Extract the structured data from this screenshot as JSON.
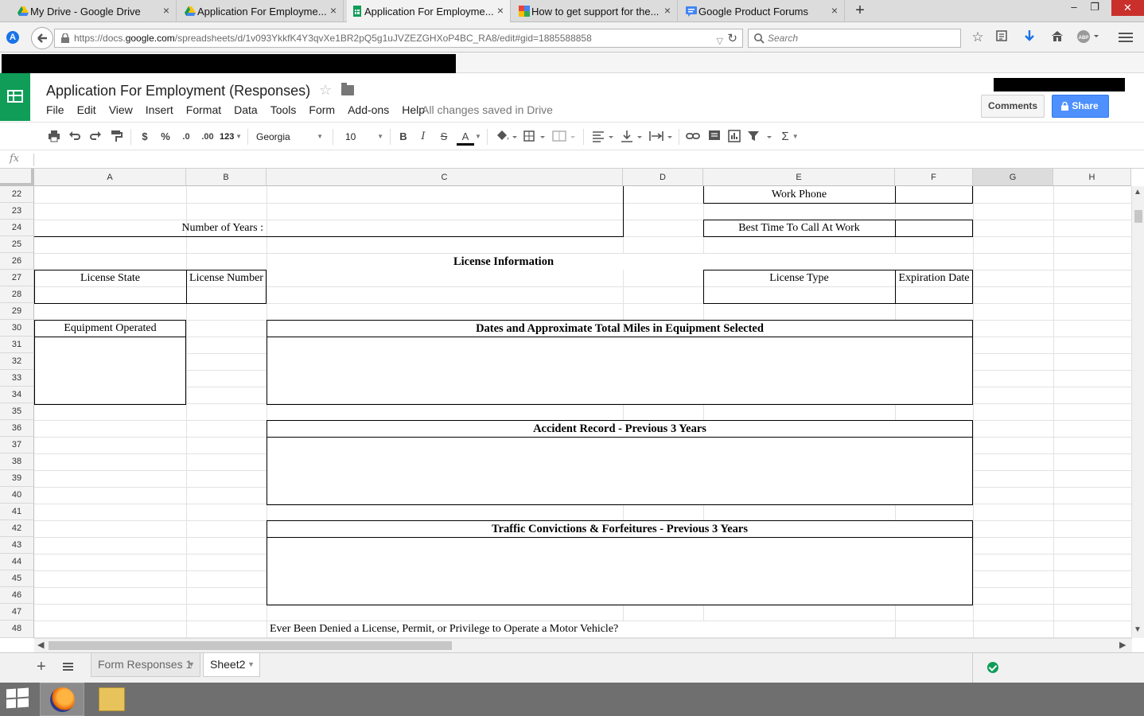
{
  "browser": {
    "tabs": [
      {
        "label": "My Drive - Google Drive"
      },
      {
        "label": "Application For Employme..."
      },
      {
        "label": "Application For Employme..."
      },
      {
        "label": "How to get support for the..."
      },
      {
        "label": "Google Product Forums"
      }
    ],
    "url_prefix": "https://docs.",
    "url_host": "google.com",
    "url_rest": "/spreadsheets/d/1v093YkkfK4Y3qvXe1BR2pQ5g1uJVZEZGHXoP4BC_RA8/edit#gid=1885588858",
    "search_placeholder": "Search"
  },
  "doc": {
    "title": "Application For Employment (Responses)",
    "menu": [
      "File",
      "Edit",
      "View",
      "Insert",
      "Format",
      "Data",
      "Tools",
      "Form",
      "Add-ons",
      "Help"
    ],
    "status": "All changes saved in Drive",
    "comments_label": "Comments",
    "share_label": "Share"
  },
  "toolbar": {
    "currency": "$",
    "percent": "%",
    "dec_less": ".0",
    "dec_more": ".00",
    "format_more": "123",
    "font": "Georgia",
    "size": "10",
    "bold": "B",
    "italic": "I",
    "strike": "S",
    "text_color": "A"
  },
  "formula": {
    "fx": "fx"
  },
  "grid": {
    "columns": [
      "A",
      "B",
      "C",
      "D",
      "E",
      "F",
      "G",
      "H"
    ],
    "rows": [
      "22",
      "23",
      "24",
      "25",
      "26",
      "27",
      "28",
      "29",
      "30",
      "31",
      "32",
      "33",
      "34",
      "35",
      "36",
      "37",
      "38",
      "39",
      "40",
      "41",
      "42",
      "43",
      "44",
      "45",
      "46",
      "47",
      "48"
    ],
    "cells": {
      "work_phone": "Work Phone",
      "number_of_years": "Number of Years :",
      "best_time": "Best Time To Call At Work",
      "license_info": "License Information",
      "license_state": "License State",
      "license_number": "License Number",
      "license_type": "License Type",
      "expiration_date": "Expiration Date",
      "equipment_operated": "Equipment Operated",
      "dates_miles": "Dates and Approximate Total Miles in Equipment Selected",
      "accident_record": "Accident Record - Previous 3 Years",
      "traffic_convictions": "Traffic Convictions & Forfeitures - Previous 3 Years",
      "ever_denied": "Ever Been Denied a License, Permit, or Privilege to Operate a Motor Vehicle?"
    }
  },
  "sheets": {
    "tabs": [
      {
        "label": "Form Responses 1"
      },
      {
        "label": "Sheet2"
      }
    ]
  },
  "colors": {
    "sheets_green": "#0f9d58",
    "share_blue": "#4d90fe"
  }
}
